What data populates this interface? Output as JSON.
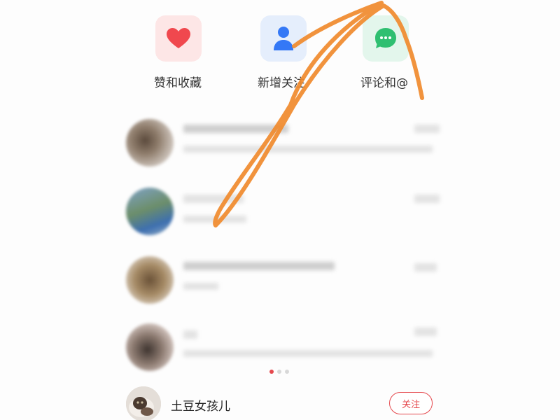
{
  "categories": [
    {
      "label": "赞和收藏",
      "icon": "heart-icon",
      "icon_color": "#f0484e",
      "bg_color": "#fde6e6"
    },
    {
      "label": "新增关注",
      "icon": "person-icon",
      "icon_color": "#3478f6",
      "bg_color": "#e5eefc"
    },
    {
      "label": "评论和@",
      "icon": "chat-bubble-icon",
      "icon_color": "#2fbf71",
      "bg_color": "#e3f6ec"
    }
  ],
  "pager": {
    "count": 3,
    "active_index": 0,
    "active_color": "#e5484d"
  },
  "recommended_user": {
    "name": "土豆女孩儿",
    "follow_label": "关注"
  },
  "colors": {
    "accent": "#e5484d",
    "annotation": "#f08a2c"
  }
}
